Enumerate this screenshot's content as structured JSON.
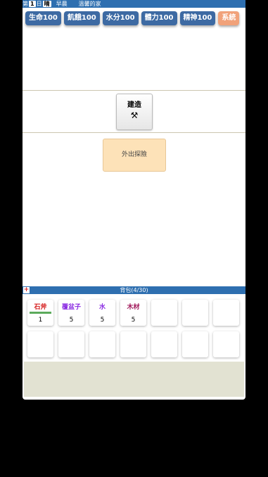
{
  "status": {
    "day_prefix": "第",
    "day_number": "1",
    "day_suffix": "日",
    "weather": "晴",
    "time": "早晨",
    "location": "溫馨的家"
  },
  "stats": [
    {
      "label": "生命100"
    },
    {
      "label": "飢餓100"
    },
    {
      "label": "水分100"
    },
    {
      "label": "體力100"
    },
    {
      "label": "精神100"
    }
  ],
  "system_button": "系統",
  "build_button": {
    "label": "建造",
    "icon": "hammer-pick-icon"
  },
  "outing_button": {
    "label": "外出探險"
  },
  "bag": {
    "title": "背包(4/30)",
    "add_symbol": "+",
    "items": [
      {
        "name": "石斧",
        "qty": "1",
        "color": "#d62020",
        "durability": 1.0
      },
      {
        "name": "覆盆子",
        "qty": "5",
        "color": "#8a2be2"
      },
      {
        "name": "水",
        "qty": "5",
        "color": "#8a2be2"
      },
      {
        "name": "木材",
        "qty": "5",
        "color": "#a0185a"
      }
    ]
  },
  "colors": {
    "bar_blue": "#2e6fb0",
    "stat_blue": "#3d6aa3",
    "system_orange": "#f1a27a",
    "outing_bg": "#fde2b8",
    "footer_bg": "#e2e2d2"
  }
}
